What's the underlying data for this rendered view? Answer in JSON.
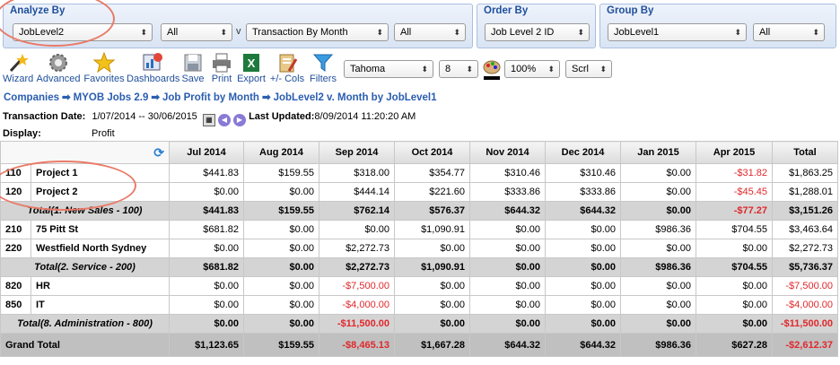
{
  "analyze": {
    "title": "Analyze By",
    "field": "JobLevel2",
    "filter": "All",
    "v_label": "v",
    "period": "Transaction By Month",
    "period_filter": "All"
  },
  "order": {
    "title": "Order By",
    "value": "Job Level 2 ID"
  },
  "group": {
    "title": "Group By",
    "value": "JobLevel1",
    "filter": "All"
  },
  "toolbar": {
    "wizard": "Wizard",
    "advanced": "Advanced",
    "favorites": "Favorites",
    "dashboards": "Dashboards",
    "save": "Save",
    "print": "Print",
    "export": "Export",
    "cols": "+/- Cols",
    "filters": "Filters",
    "font": "Tahoma",
    "size": "8",
    "zoom": "100%",
    "scroll": "Scrl"
  },
  "breadcrumb": [
    "Companies",
    "MYOB Jobs 2.9",
    "Job Profit by Month",
    "JobLevel2 v. Month by JobLevel1"
  ],
  "breadcrumb_sep": "➡",
  "transaction": {
    "label": "Transaction Date:",
    "value": "1/07/2014 -- 30/06/2015",
    "updated_label": "Last Updated:",
    "updated_value": "8/09/2014 11:20:20 AM"
  },
  "display": {
    "label": "Display:",
    "value": "Profit"
  },
  "columns": [
    "Jul 2014",
    "Aug 2014",
    "Sep 2014",
    "Oct 2014",
    "Nov 2014",
    "Dec 2014",
    "Jan 2015",
    "Apr 2015",
    "Total"
  ],
  "rows": [
    {
      "type": "row",
      "code": "110",
      "name": "Project 1",
      "values": [
        "$441.83",
        "$159.55",
        "$318.00",
        "$354.77",
        "$310.46",
        "$310.46",
        "$0.00",
        "-$31.82",
        "$1,863.25"
      ]
    },
    {
      "type": "row",
      "code": "120",
      "name": "Project 2",
      "values": [
        "$0.00",
        "$0.00",
        "$444.14",
        "$221.60",
        "$333.86",
        "$333.86",
        "$0.00",
        "-$45.45",
        "$1,288.01"
      ]
    },
    {
      "type": "total",
      "name": "Total(1. New Sales - 100)",
      "values": [
        "$441.83",
        "$159.55",
        "$762.14",
        "$576.37",
        "$644.32",
        "$644.32",
        "$0.00",
        "-$77.27",
        "$3,151.26"
      ]
    },
    {
      "type": "row",
      "code": "210",
      "name": "75 Pitt St",
      "values": [
        "$681.82",
        "$0.00",
        "$0.00",
        "$1,090.91",
        "$0.00",
        "$0.00",
        "$986.36",
        "$704.55",
        "$3,463.64"
      ]
    },
    {
      "type": "row",
      "code": "220",
      "name": "Westfield North Sydney",
      "values": [
        "$0.00",
        "$0.00",
        "$2,272.73",
        "$0.00",
        "$0.00",
        "$0.00",
        "$0.00",
        "$0.00",
        "$2,272.73"
      ]
    },
    {
      "type": "total",
      "name": "Total(2. Service - 200)",
      "values": [
        "$681.82",
        "$0.00",
        "$2,272.73",
        "$1,090.91",
        "$0.00",
        "$0.00",
        "$986.36",
        "$704.55",
        "$5,736.37"
      ]
    },
    {
      "type": "row",
      "code": "820",
      "name": "HR",
      "values": [
        "$0.00",
        "$0.00",
        "-$7,500.00",
        "$0.00",
        "$0.00",
        "$0.00",
        "$0.00",
        "$0.00",
        "-$7,500.00"
      ]
    },
    {
      "type": "row",
      "code": "850",
      "name": "IT",
      "values": [
        "$0.00",
        "$0.00",
        "-$4,000.00",
        "$0.00",
        "$0.00",
        "$0.00",
        "$0.00",
        "$0.00",
        "-$4,000.00"
      ]
    },
    {
      "type": "total",
      "name": "Total(8. Administration - 800)",
      "values": [
        "$0.00",
        "$0.00",
        "-$11,500.00",
        "$0.00",
        "$0.00",
        "$0.00",
        "$0.00",
        "$0.00",
        "-$11,500.00"
      ]
    },
    {
      "type": "grand",
      "name": "Grand Total",
      "values": [
        "$1,123.65",
        "$159.55",
        "-$8,465.13",
        "$1,667.28",
        "$644.32",
        "$644.32",
        "$986.36",
        "$627.28",
        "-$2,612.37"
      ]
    }
  ],
  "colors": {
    "negative": "#e0282c",
    "link": "#2a5db0",
    "annotation": "#e97a68"
  }
}
